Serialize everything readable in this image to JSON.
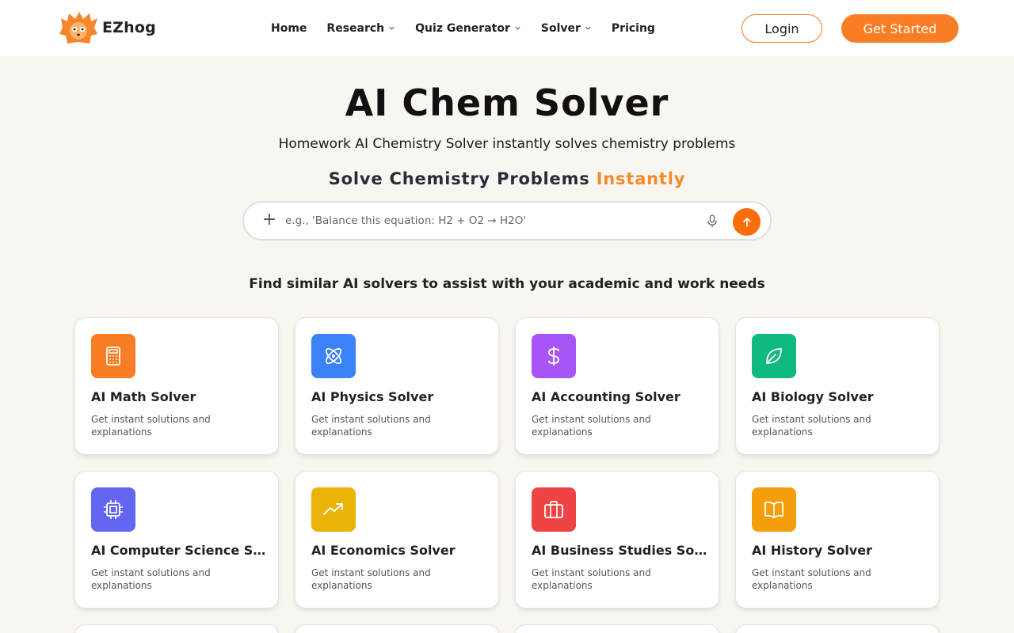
{
  "brand": {
    "name": "EZhog"
  },
  "nav": {
    "links": [
      {
        "label": "Home",
        "has_dropdown": false
      },
      {
        "label": "Research",
        "has_dropdown": true
      },
      {
        "label": "Quiz Generator",
        "has_dropdown": true
      },
      {
        "label": "Solver",
        "has_dropdown": true
      },
      {
        "label": "Pricing",
        "has_dropdown": false
      }
    ],
    "login_label": "Login",
    "get_started_label": "Get Started"
  },
  "hero": {
    "title": "AI Chem Solver",
    "subtitle": "Homework AI Chemistry Solver instantly solves chemistry problems",
    "tagline_main": "Solve Chemistry Problems",
    "tagline_accent": "Instantly"
  },
  "search": {
    "placeholder": "e.g., 'Balance this equation: H2 + O2 → H2O'",
    "value": ""
  },
  "similar": {
    "title": "Find similar AI solvers to assist with your academic and work needs",
    "cards": [
      {
        "title": "AI Math Solver",
        "desc": "Get instant solutions and explanations",
        "icon": "calculator-icon",
        "color": "#f97d25"
      },
      {
        "title": "AI Physics Solver",
        "desc": "Get instant solutions and explanations",
        "icon": "atom-icon",
        "color": "#3b82f6"
      },
      {
        "title": "AI Accounting Solver",
        "desc": "Get instant solutions and explanations",
        "icon": "dollar-icon",
        "color": "#a855f7"
      },
      {
        "title": "AI Biology Solver",
        "desc": "Get instant solutions and explanations",
        "icon": "leaf-icon",
        "color": "#10b981"
      },
      {
        "title": "AI Computer Science Solver",
        "desc": "Get instant solutions and explanations",
        "icon": "cpu-icon",
        "color": "#6366f1"
      },
      {
        "title": "AI Economics Solver",
        "desc": "Get instant solutions and explanations",
        "icon": "trending-up-icon",
        "color": "#eab308"
      },
      {
        "title": "AI Business Studies Solver",
        "desc": "Get instant solutions and explanations",
        "icon": "briefcase-icon",
        "color": "#ef4444"
      },
      {
        "title": "AI History Solver",
        "desc": "Get instant solutions and explanations",
        "icon": "book-icon",
        "color": "#f59e0b"
      }
    ]
  }
}
